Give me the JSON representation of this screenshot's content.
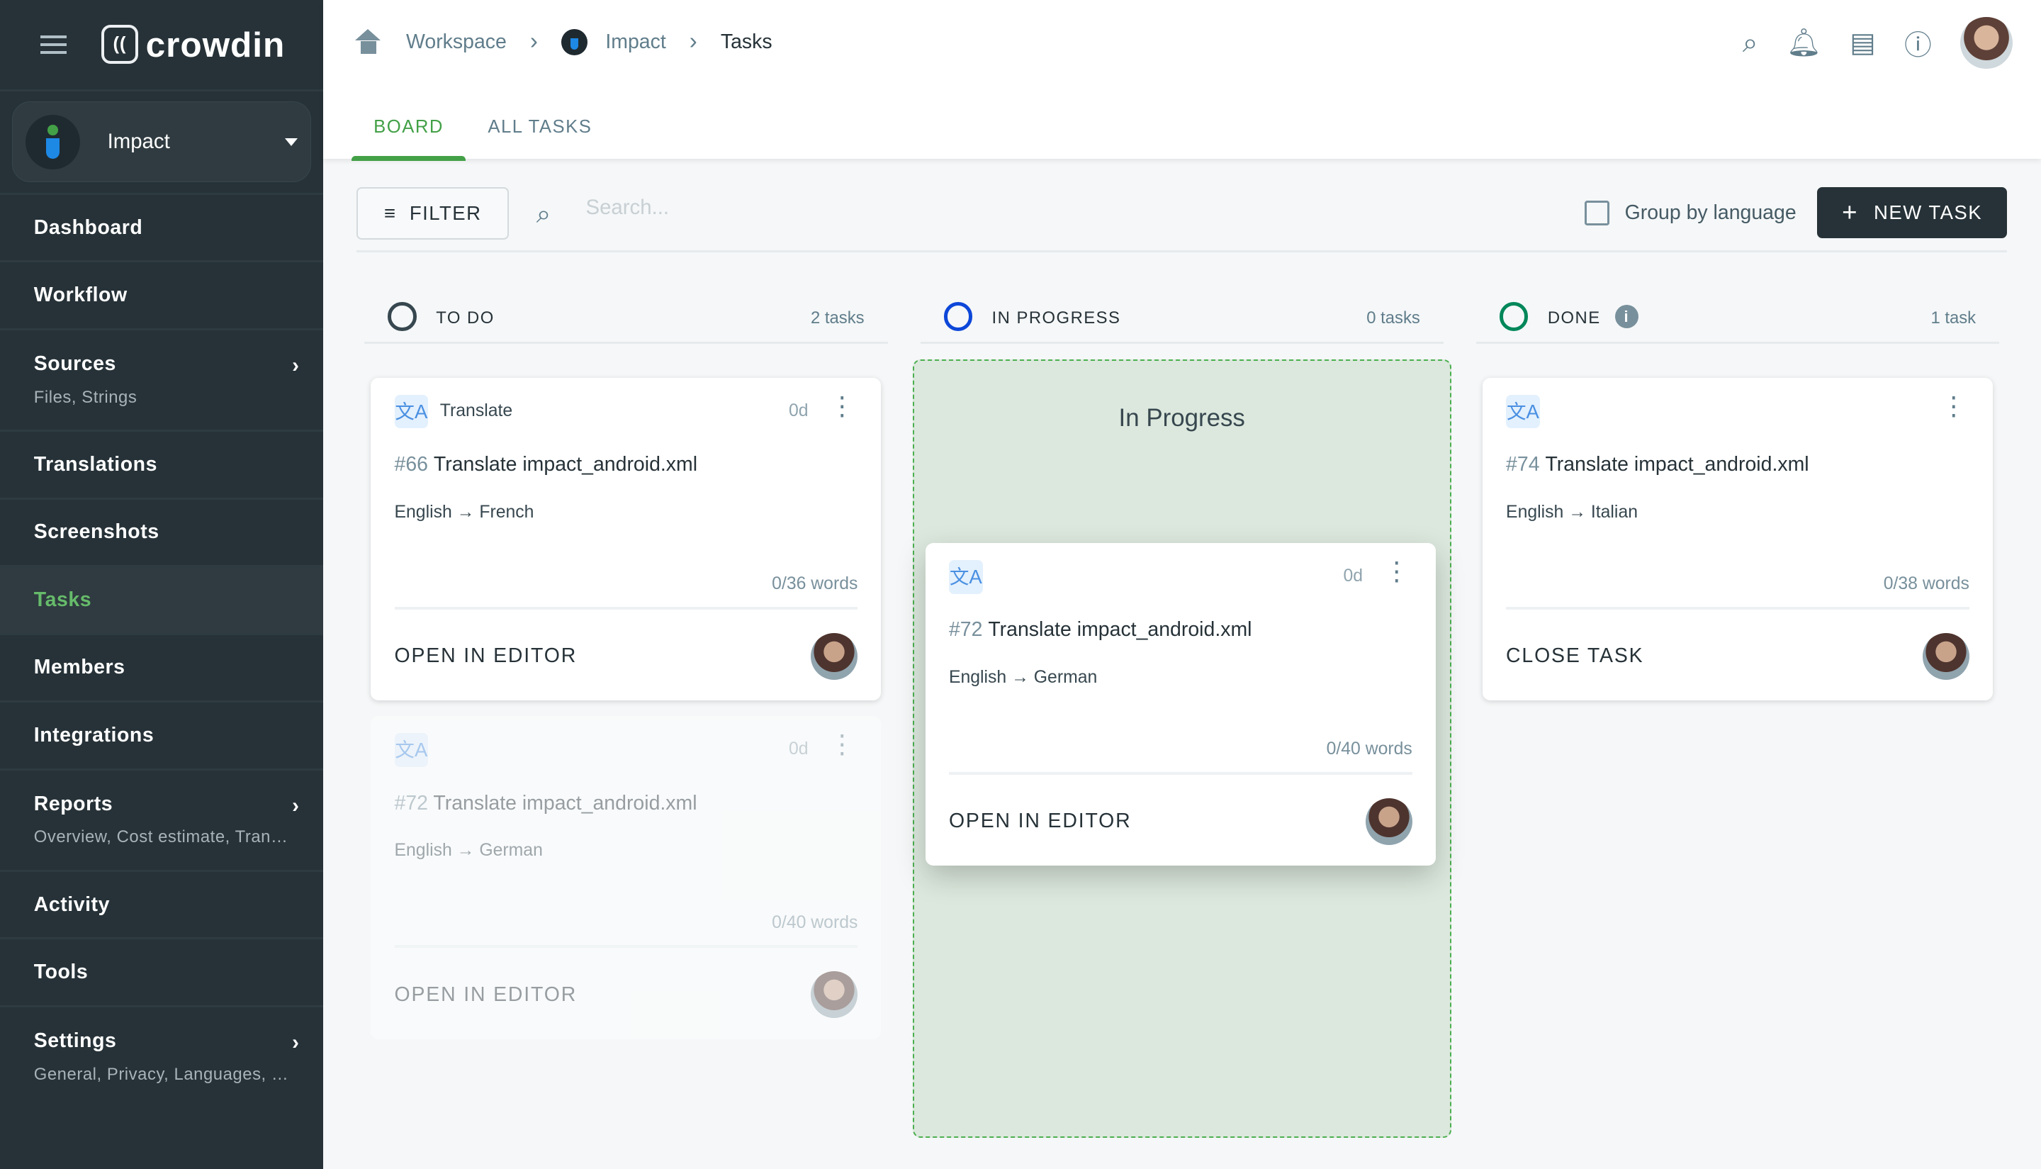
{
  "app": {
    "logo": "crowdin",
    "project": "Impact"
  },
  "sidebar": {
    "items": [
      {
        "label": "Dashboard"
      },
      {
        "label": "Workflow"
      },
      {
        "label": "Sources",
        "sub": "Files, Strings"
      },
      {
        "label": "Translations"
      },
      {
        "label": "Screenshots"
      },
      {
        "label": "Tasks",
        "active": true
      },
      {
        "label": "Members"
      },
      {
        "label": "Integrations"
      },
      {
        "label": "Reports",
        "sub": "Overview, Cost estimate, Transl..."
      },
      {
        "label": "Activity"
      },
      {
        "label": "Tools"
      },
      {
        "label": "Settings",
        "sub": "General, Privacy, Languages, Q..."
      }
    ]
  },
  "breadcrumb": [
    "Workspace",
    "Impact",
    "Tasks"
  ],
  "tabs": [
    "BOARD",
    "ALL TASKS"
  ],
  "toolbar": {
    "filter": "FILTER",
    "search_placeholder": "Search...",
    "group_by": "Group by language",
    "new_task": "NEW TASK"
  },
  "colors": {
    "sidebar": "#263238",
    "accent": "#43a047",
    "todo": "#37474f",
    "in_progress": "#0d47d9",
    "done": "#00875a"
  },
  "columns": [
    {
      "title": "TO DO",
      "count": "2 tasks"
    },
    {
      "title": "IN PROGRESS",
      "count": "0 tasks",
      "drop_label": "In Progress"
    },
    {
      "title": "DONE",
      "count": "1 task"
    }
  ],
  "cards": [
    {
      "type": "Translate",
      "due": "0d",
      "num": "#66",
      "name": "Translate impact_android.xml",
      "lang": "English → French",
      "words": "0/36 words",
      "action": "OPEN IN EDITOR"
    },
    {
      "due": "0d",
      "num": "#72",
      "name": "Translate impact_android.xml",
      "lang": "English → German",
      "words": "0/40 words",
      "action": "OPEN IN EDITOR"
    },
    {
      "due": "0d",
      "num": "#72",
      "name": "Translate impact_android.xml",
      "lang": "English → German",
      "words": "0/40 words",
      "action": "OPEN IN EDITOR"
    },
    {
      "num": "#74",
      "name": "Translate impact_android.xml",
      "lang": "English → Italian",
      "words": "0/38 words",
      "action": "CLOSE TASK"
    }
  ]
}
